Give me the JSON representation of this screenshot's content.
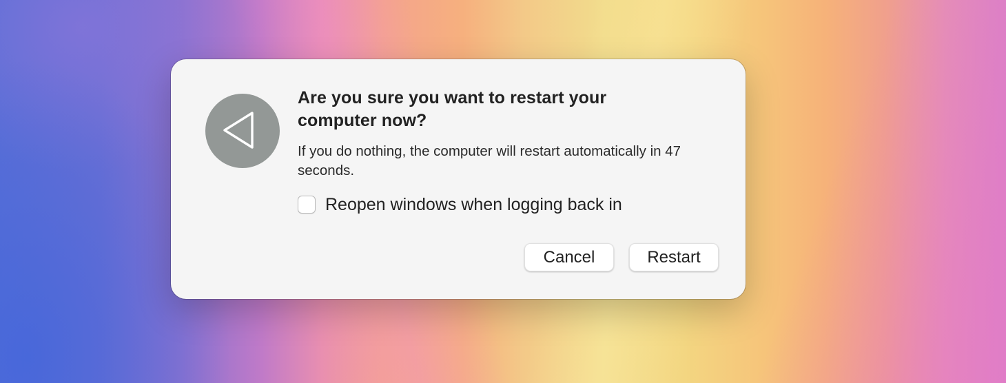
{
  "dialog": {
    "icon": "restart-arrow-icon",
    "title": "Are you sure you want to restart your computer now?",
    "message": "If you do nothing, the computer will restart automatically in 47 seconds.",
    "checkbox": {
      "label": "Reopen windows when logging back in",
      "checked": false
    },
    "buttons": {
      "cancel_label": "Cancel",
      "restart_label": "Restart"
    },
    "colors": {
      "icon_background": "#939896",
      "dialog_background": "#f5f5f5"
    }
  }
}
